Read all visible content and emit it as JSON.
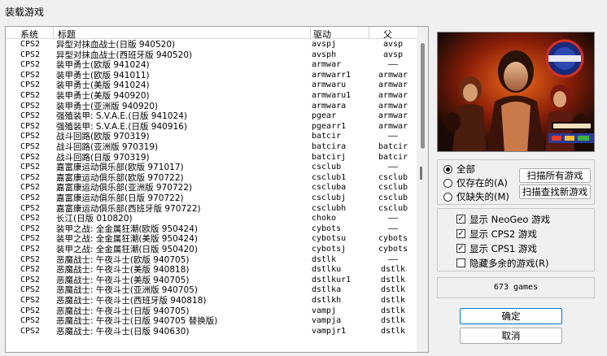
{
  "window": {
    "title": "装载游戏"
  },
  "list": {
    "headers": {
      "system": "系统",
      "title": "标题",
      "driver": "驱动",
      "parent": "父"
    },
    "rows": [
      {
        "system": "CPS2",
        "title": "异型对抹血战士(日版 940520)",
        "driver": "avspj",
        "parent": "avsp"
      },
      {
        "system": "CPS2",
        "title": "异型对抹血战士(西班牙版 940520)",
        "driver": "avsph",
        "parent": "avsp"
      },
      {
        "system": "CPS2",
        "title": "装甲勇士(欧版 941024)",
        "driver": "armwar",
        "parent": "——"
      },
      {
        "system": "CPS2",
        "title": "装甲勇士(欧版 941011)",
        "driver": "armwarr1",
        "parent": "armwar"
      },
      {
        "system": "CPS2",
        "title": "装甲勇士(美版 941024)",
        "driver": "armwaru",
        "parent": "armwar"
      },
      {
        "system": "CPS2",
        "title": "装甲勇士(美版 940920)",
        "driver": "armwaru1",
        "parent": "armwar"
      },
      {
        "system": "CPS2",
        "title": "装甲勇士(亚洲版 940920)",
        "driver": "armwara",
        "parent": "armwar"
      },
      {
        "system": "CPS2",
        "title": "强殖装甲: S.V.A.E.(日版 941024)",
        "driver": "pgear",
        "parent": "armwar"
      },
      {
        "system": "CPS2",
        "title": "强殖装甲: S.V.A.E.(日版 940916)",
        "driver": "pgearr1",
        "parent": "armwar"
      },
      {
        "system": "CPS2",
        "title": "战斗回路(欧版 970319)",
        "driver": "batcir",
        "parent": "——"
      },
      {
        "system": "CPS2",
        "title": "战斗回路(亚洲版 970319)",
        "driver": "batcira",
        "parent": "batcir"
      },
      {
        "system": "CPS2",
        "title": "战斗回路(日版 970319)",
        "driver": "batcirj",
        "parent": "batcir"
      },
      {
        "system": "CPS2",
        "title": "嘉富康运动俱乐部(欧版 971017)",
        "driver": "csclub",
        "parent": "——"
      },
      {
        "system": "CPS2",
        "title": "嘉富康运动俱乐部(欧版 970722)",
        "driver": "csclub1",
        "parent": "csclub"
      },
      {
        "system": "CPS2",
        "title": "嘉富康运动俱乐部(亚洲版 970722)",
        "driver": "cscluba",
        "parent": "csclub"
      },
      {
        "system": "CPS2",
        "title": "嘉富康运动俱乐部(日版 970722)",
        "driver": "csclubj",
        "parent": "csclub"
      },
      {
        "system": "CPS2",
        "title": "嘉富康运动俱乐部(西班牙版 970722)",
        "driver": "csclubh",
        "parent": "csclub"
      },
      {
        "system": "CPS2",
        "title": "长江(日版 010820)",
        "driver": "choko",
        "parent": "——"
      },
      {
        "system": "CPS2",
        "title": "装甲之战: 全金属狂潮(欧版 950424)",
        "driver": "cybots",
        "parent": "——"
      },
      {
        "system": "CPS2",
        "title": "装甲之战: 全金属狂潮(美版 950424)",
        "driver": "cybotsu",
        "parent": "cybots"
      },
      {
        "system": "CPS2",
        "title": "装甲之战: 全金属狂潮(日版 950420)",
        "driver": "cybotsj",
        "parent": "cybots"
      },
      {
        "system": "CPS2",
        "title": "恶魔战士: 午夜斗士(欧版 940705)",
        "driver": "dstlk",
        "parent": "——"
      },
      {
        "system": "CPS2",
        "title": "恶魔战士: 午夜斗士(美版 940818)",
        "driver": "dstlku",
        "parent": "dstlk"
      },
      {
        "system": "CPS2",
        "title": "恶魔战士: 午夜斗士(美版 940705)",
        "driver": "dstlkur1",
        "parent": "dstlk"
      },
      {
        "system": "CPS2",
        "title": "恶魔战士: 午夜斗士(亚洲版 940705)",
        "driver": "dstlka",
        "parent": "dstlk"
      },
      {
        "system": "CPS2",
        "title": "恶魔战士: 午夜斗士(西班牙版 940818)",
        "driver": "dstlkh",
        "parent": "dstlk"
      },
      {
        "system": "CPS2",
        "title": "恶魔战士: 午夜斗士(日版 940705)",
        "driver": "vampj",
        "parent": "dstlk"
      },
      {
        "system": "CPS2",
        "title": "恶魔战士: 午夜斗士(日版 940705 替换版)",
        "driver": "vampja",
        "parent": "dstlk"
      },
      {
        "system": "CPS2",
        "title": "恶魔战士: 午夜斗士(日版 940630)",
        "driver": "vampjr1",
        "parent": "dstlk"
      }
    ]
  },
  "filter": {
    "all": "全部",
    "existing": "仅存在的(A)",
    "missing": "仅缺失的(M)",
    "selected": "all",
    "scan_all": "扫描所有游戏",
    "scan_new": "扫描查找新游戏"
  },
  "display": {
    "neogeo": {
      "label": "显示 NeoGeo 游戏",
      "checked": true
    },
    "cps2": {
      "label": "显示 CPS2 游戏",
      "checked": true
    },
    "cps1": {
      "label": "显示 CPS1 游戏",
      "checked": true
    },
    "hide_extra": {
      "label": "隐藏多余的游戏(R)",
      "checked": false
    }
  },
  "game_count": "673 games",
  "buttons": {
    "ok": "确定",
    "cancel": "取消"
  },
  "colors": {
    "accent": "#0078d7",
    "preview_bg": "#1a0a06"
  },
  "icons": {
    "check": "✓"
  }
}
